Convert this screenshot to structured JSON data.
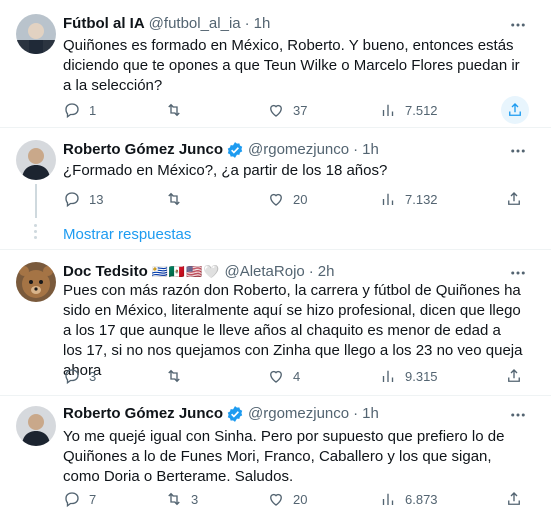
{
  "tweets": [
    {
      "name": "Fútbol al IA",
      "handle": "@futbol_al_ia",
      "dot": "·",
      "time": "1h",
      "verified": false,
      "text": "Quiñones es formado en México, Roberto. Y bueno, entonces estás diciendo que te opones a que Teun Wilke o Marcelo Flores puedan ir a la selección?",
      "replies": "1",
      "retweets": "",
      "likes": "37",
      "views": "7.512"
    },
    {
      "name": "Roberto Gómez Junco",
      "handle": "@rgomezjunco",
      "dot": "·",
      "time": "1h",
      "verified": true,
      "text": "¿Formado en México?, ¿a partir de los 18 años?",
      "replies": "13",
      "retweets": "",
      "likes": "20",
      "views": "7.132"
    },
    {
      "name": "Doc Tedsito",
      "flags": "🇺🇾🇲🇽🇺🇸🤍",
      "handle": "@AletaRojo",
      "dot": "·",
      "time": "2h",
      "verified": false,
      "text": "Pues con más razón don Roberto, la carrera y fútbol de Quiñones ha sido en México, literalmente aquí se hizo profesional, dicen que llego a los 17 que aunque le lleve años al chaquito es menor de edad a los 17, si no nos quejamos con Zinha que llego a los 23 no veo queja ahora",
      "replies": "3",
      "retweets": "",
      "likes": "4",
      "views": "9.315"
    },
    {
      "name": "Roberto Gómez Junco",
      "handle": "@rgomezjunco",
      "dot": "·",
      "time": "1h",
      "verified": true,
      "text": "Yo me quejé igual con Sinha. Pero por supuesto que prefiero lo de Quiñones a lo de Funes Mori, Franco, Caballero y los que sigan, como Doria o Berterame. Saludos.",
      "replies": "7",
      "retweets": "3",
      "likes": "20",
      "views": "6.873"
    }
  ],
  "show_replies_label": "Mostrar respuestas",
  "colors": {
    "accent": "#1d9bf0",
    "muted": "#536471",
    "text": "#0f1419"
  }
}
